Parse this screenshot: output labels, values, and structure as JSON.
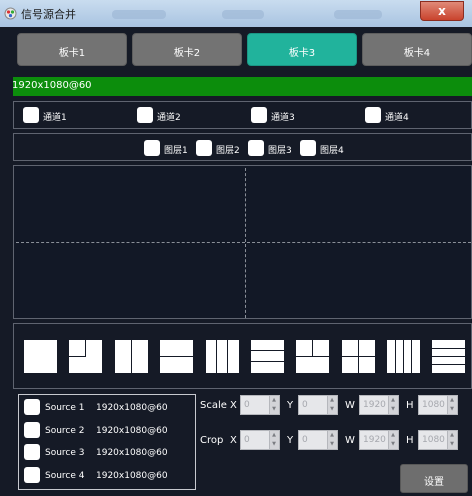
{
  "window": {
    "title": "信号源合并",
    "close_glyph": "x",
    "accent": "#21b39c"
  },
  "tabs": [
    {
      "label": "板卡1",
      "active": false
    },
    {
      "label": "板卡2",
      "active": false
    },
    {
      "label": "板卡3",
      "active": true
    },
    {
      "label": "板卡4",
      "active": false
    }
  ],
  "resolution_bar": {
    "text": "1920x1080@60",
    "color": "#0c8d0c"
  },
  "channels": [
    {
      "label": "通道1"
    },
    {
      "label": "通道2"
    },
    {
      "label": "通道3"
    },
    {
      "label": "通道4"
    }
  ],
  "layers": [
    {
      "label": "图层1"
    },
    {
      "label": "图层2"
    },
    {
      "label": "图层3"
    },
    {
      "label": "图层4"
    }
  ],
  "layouts": [
    "single-layout-icon",
    "inset-corner-layout-icon",
    "two-column-layout-icon",
    "two-row-layout-icon",
    "three-column-layout-icon",
    "three-row-layout-icon",
    "quad-split-layout-icon",
    "quad-grid-layout-icon",
    "four-column-layout-icon",
    "four-row-layout-icon"
  ],
  "sources": [
    {
      "name": "Source 1",
      "res": "1920x1080@60"
    },
    {
      "name": "Source 2",
      "res": "1920x1080@60"
    },
    {
      "name": "Source 3",
      "res": "1920x1080@60"
    },
    {
      "name": "Source 4",
      "res": "1920x1080@60"
    }
  ],
  "scale": {
    "label": "Scale",
    "x_label": "X",
    "y_label": "Y",
    "w_label": "W",
    "h_label": "H",
    "x": "0",
    "y": "0",
    "w": "1920",
    "h": "1080"
  },
  "crop": {
    "label": "Crop",
    "x_label": "X",
    "y_label": "Y",
    "w_label": "W",
    "h_label": "H",
    "x": "0",
    "y": "0",
    "w": "1920",
    "h": "1080"
  },
  "apply_button": "设置"
}
